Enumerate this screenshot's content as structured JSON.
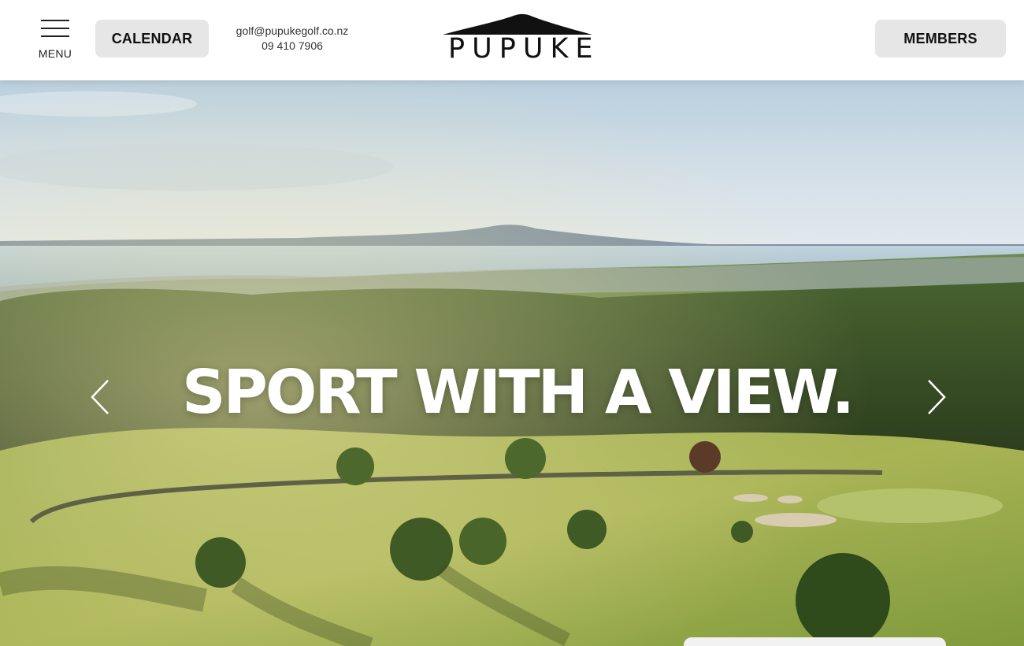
{
  "header": {
    "menu_label": "MENU",
    "calendar_label": "CALENDAR",
    "contact_email": "golf@pupukegolf.co.nz",
    "contact_phone": "09 410 7906",
    "logo_text": "PUPUKE",
    "members_label": "MEMBERS"
  },
  "hero": {
    "headline": "SPORT WITH A VIEW.",
    "prev_icon": "chevron-left-icon",
    "next_icon": "chevron-right-icon"
  },
  "colors": {
    "header_bg": "#ffffff",
    "button_bg": "#e6e6e6",
    "text_dark": "#111111",
    "headline": "#ffffff"
  },
  "icons": [
    "hamburger-icon",
    "mountain-logo-icon",
    "chevron-left-icon",
    "chevron-right-icon"
  ]
}
